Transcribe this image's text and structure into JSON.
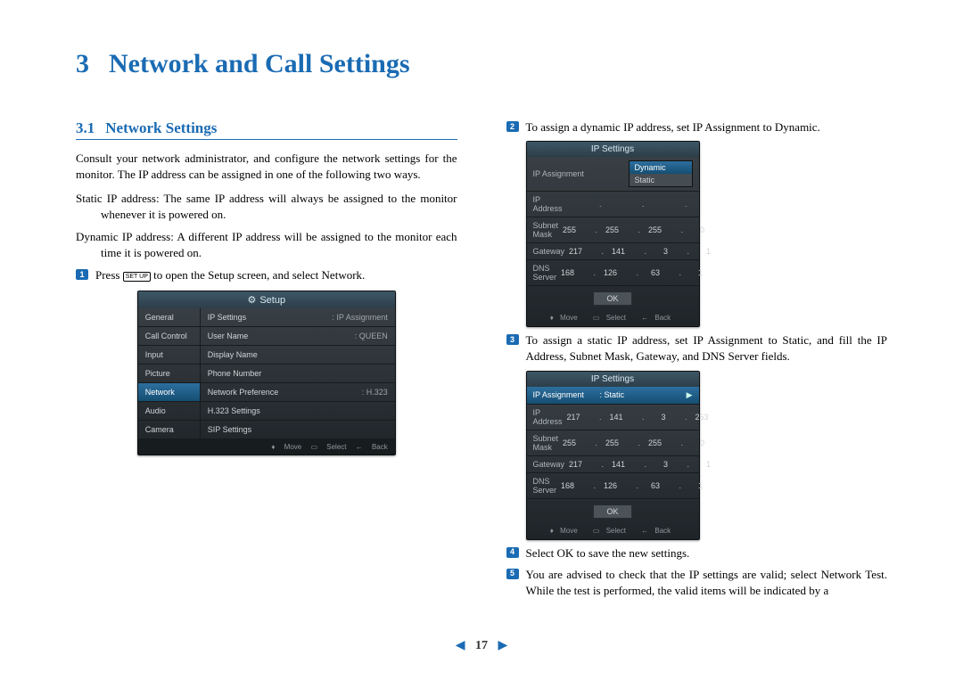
{
  "chapter": {
    "number": "3",
    "title": "Network and Call Settings"
  },
  "section": {
    "number": "3.1",
    "title": "Network Settings"
  },
  "intro": "Consult your network administrator, and configure the network settings for the monitor. The IP address can be assigned in one of the following two ways.",
  "defs": {
    "static": "Static IP address:  The same IP address will always be assigned to the monitor whenever it is powered on.",
    "dynamic": "Dynamic IP address:  A different IP address will be assigned to the monitor each time it is powered on."
  },
  "steps": {
    "s1_a": "Press ",
    "s1_key": "SET UP",
    "s1_b": " to open the Setup screen, and select Network.",
    "s2": "To assign a dynamic IP address, set IP Assignment to Dynamic.",
    "s3": "To assign a static IP address, set IP Assignment to Static, and fill the IP Address, Subnet Mask, Gateway, and DNS Server fields.",
    "s4": "Select OK to save the new settings.",
    "s5": "You are advised to check that the IP settings are valid; select Network Test. While the test is performed, the valid items will be indicated by a"
  },
  "osd1": {
    "title": "Setup",
    "nav": [
      "General",
      "Call Control",
      "Input",
      "Picture",
      "Network",
      "Audio",
      "Camera"
    ],
    "nav_selected": "Network",
    "rows": [
      {
        "label": "IP Settings",
        "value": ": IP Assignment"
      },
      {
        "label": "User Name",
        "value": ": QUEEN"
      },
      {
        "label": "Display Name",
        "value": ""
      },
      {
        "label": "Phone Number",
        "value": ""
      },
      {
        "label": "Network Preference",
        "value": ": H.323"
      },
      {
        "label": "H.323 Settings",
        "value": ""
      },
      {
        "label": "SIP Settings",
        "value": ""
      }
    ],
    "footer": {
      "move": "Move",
      "select": "Select",
      "back": "Back"
    }
  },
  "osd2": {
    "title": "IP Settings",
    "assignment_label": "IP Assignment",
    "dropdown": {
      "options": [
        "Dynamic",
        "Static"
      ],
      "selected": "Dynamic"
    },
    "rows": [
      {
        "label": "IP Address",
        "ip": [
          "",
          "",
          "",
          ""
        ]
      },
      {
        "label": "Subnet Mask",
        "ip": [
          "255",
          "255",
          "255",
          "0"
        ]
      },
      {
        "label": "Gateway",
        "ip": [
          "217",
          "141",
          "3",
          "1"
        ]
      },
      {
        "label": "DNS Server",
        "ip": [
          "168",
          "126",
          "63",
          "1"
        ]
      }
    ],
    "ok": "OK",
    "footer": {
      "move": "Move",
      "select": "Select",
      "back": "Back"
    }
  },
  "osd3": {
    "title": "IP Settings",
    "selected": {
      "label": "IP Assignment",
      "value": ": Static"
    },
    "rows": [
      {
        "label": "IP Address",
        "ip": [
          "217",
          "141",
          "3",
          "253"
        ]
      },
      {
        "label": "Subnet Mask",
        "ip": [
          "255",
          "255",
          "255",
          "0"
        ]
      },
      {
        "label": "Gateway",
        "ip": [
          "217",
          "141",
          "3",
          "1"
        ]
      },
      {
        "label": "DNS Server",
        "ip": [
          "168",
          "126",
          "63",
          "1"
        ]
      }
    ],
    "ok": "OK",
    "footer": {
      "move": "Move",
      "select": "Select",
      "back": "Back"
    }
  },
  "page_nav": {
    "number": "17"
  }
}
